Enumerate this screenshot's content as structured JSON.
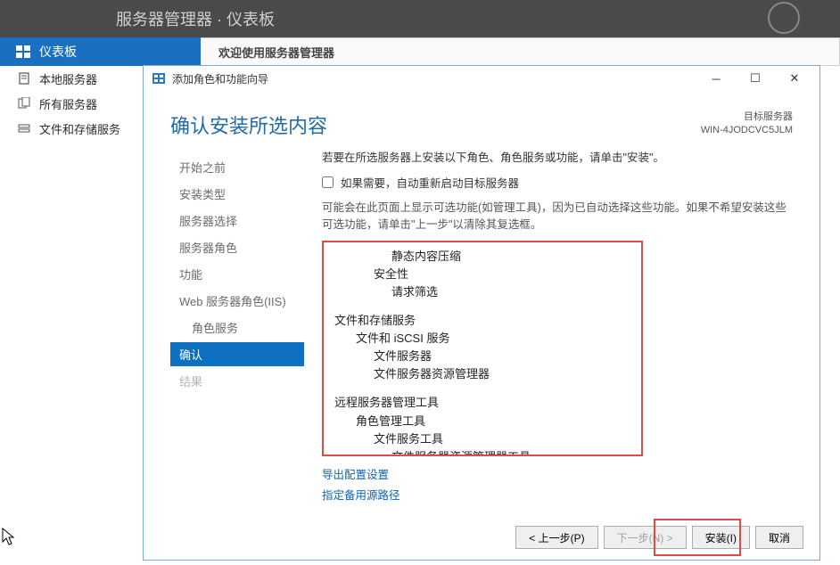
{
  "topbar": {
    "title_fragment": "服务器管理器 · 仪表板"
  },
  "sidebar": {
    "dashboard": "仪表板",
    "local_server": "本地服务器",
    "all_servers": "所有服务器",
    "file_storage": "文件和存储服务"
  },
  "welcome_bar": "欢迎使用服务器管理器",
  "wizard": {
    "titlebar": "添加角色和功能向导",
    "heading": "确认安装所选内容",
    "dest_label": "目标服务器",
    "dest_value": "WIN-4JODCVC5JLM",
    "steps": {
      "before": "开始之前",
      "install_type": "安装类型",
      "server_select": "服务器选择",
      "server_roles": "服务器角色",
      "features": "功能",
      "web_iis": "Web 服务器角色(IIS)",
      "role_services": "角色服务",
      "confirm": "确认",
      "results": "结果"
    },
    "content": {
      "instruction": "若要在所选服务器上安装以下角色、角色服务或功能，请单击\"安装\"。",
      "checkbox_label": "如果需要，自动重新启动目标服务器",
      "note": "可能会在此页面上显示可选功能(如管理工具)，因为已自动选择这些功能。如果不希望安装这些可选功能，请单击\"上一步\"以清除其复选框。"
    },
    "tree": {
      "static_compression": "静态内容压缩",
      "security": "安全性",
      "request_filtering": "请求筛选",
      "file_storage_services": "文件和存储服务",
      "file_iscsi_services": "文件和 iSCSI 服务",
      "file_server": "文件服务器",
      "fsrm": "文件服务器资源管理器",
      "rsat": "远程服务器管理工具",
      "role_admin_tools": "角色管理工具",
      "file_services_tools": "文件服务工具",
      "fsrm_tools": "文件服务器资源管理器工具"
    },
    "links": {
      "export": "导出配置设置",
      "alt_source": "指定备用源路径"
    },
    "buttons": {
      "prev": "< 上一步(P)",
      "next": "下一步(N) >",
      "install": "安装(I)",
      "cancel": "取消"
    }
  }
}
